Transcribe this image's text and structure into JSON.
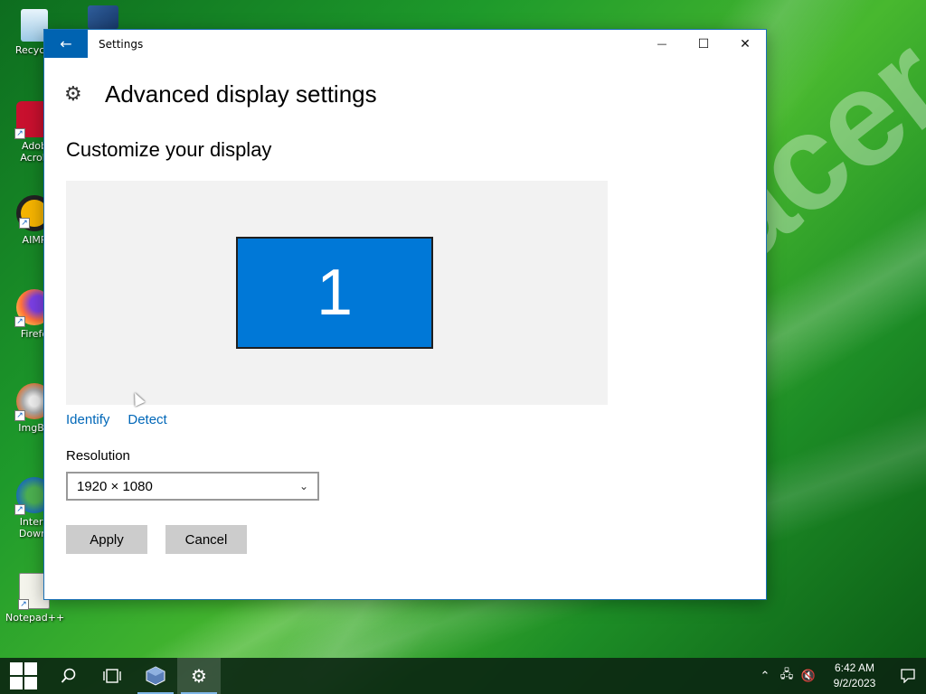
{
  "wallpaper": {
    "brand_text": "acer"
  },
  "desktop": {
    "icons": [
      {
        "label": "Recycle",
        "icon": "recycle-bin-icon"
      },
      {
        "label": "Adob\nAcrob",
        "icon": "acrobat-icon"
      },
      {
        "label": "AIMP",
        "icon": "aimp-icon"
      },
      {
        "label": "Firefo",
        "icon": "firefox-icon"
      },
      {
        "label": "ImgBu",
        "icon": "imgburn-icon"
      },
      {
        "label": "Intern\nDownl",
        "icon": "internet-download-manager-icon"
      },
      {
        "label": "Notepad++",
        "icon": "notepad-plus-plus-icon"
      }
    ]
  },
  "window": {
    "title": "Settings",
    "back_icon": "←",
    "minimize": "—",
    "maximize": "☐",
    "close": "✕"
  },
  "page": {
    "gear_icon": "⚙",
    "title": "Advanced display settings",
    "section_title": "Customize your display",
    "monitor_number": "1",
    "identify_link": "Identify",
    "detect_link": "Detect",
    "resolution_label": "Resolution",
    "resolution_value": "1920 × 1080",
    "apply_label": "Apply",
    "cancel_label": "Cancel"
  },
  "taskbar": {
    "items": [
      {
        "name": "start",
        "icon": "windows-logo-icon"
      },
      {
        "name": "search",
        "icon": "search-icon"
      },
      {
        "name": "task-view",
        "icon": "task-view-icon"
      },
      {
        "name": "virtualbox",
        "icon": "virtualbox-icon"
      },
      {
        "name": "settings",
        "icon": "gear-icon"
      }
    ],
    "time": "6:42 AM",
    "date": "9/2/2023"
  },
  "colors": {
    "accent": "#0078d7",
    "link": "#0067b8",
    "back_button": "#0063b1"
  }
}
